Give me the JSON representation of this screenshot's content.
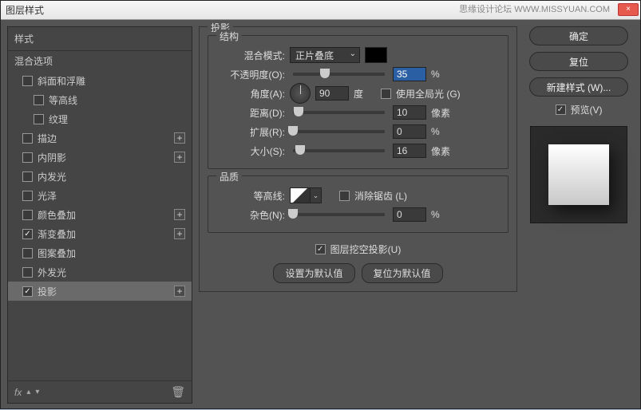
{
  "window": {
    "title": "图层样式",
    "watermark": "思缘设计论坛  WWW.MISSYUAN.COM",
    "close": "×"
  },
  "sidebar": {
    "header": "样式",
    "section": "混合选项",
    "items": [
      {
        "label": "斜面和浮雕",
        "checked": false,
        "plus": false,
        "sub": false
      },
      {
        "label": "等高线",
        "checked": false,
        "plus": false,
        "sub": true
      },
      {
        "label": "纹理",
        "checked": false,
        "plus": false,
        "sub": true
      },
      {
        "label": "描边",
        "checked": false,
        "plus": true,
        "sub": false
      },
      {
        "label": "内阴影",
        "checked": false,
        "plus": true,
        "sub": false
      },
      {
        "label": "内发光",
        "checked": false,
        "plus": false,
        "sub": false
      },
      {
        "label": "光泽",
        "checked": false,
        "plus": false,
        "sub": false
      },
      {
        "label": "颜色叠加",
        "checked": false,
        "plus": true,
        "sub": false
      },
      {
        "label": "渐变叠加",
        "checked": true,
        "plus": true,
        "sub": false
      },
      {
        "label": "图案叠加",
        "checked": false,
        "plus": false,
        "sub": false
      },
      {
        "label": "外发光",
        "checked": false,
        "plus": false,
        "sub": false
      },
      {
        "label": "投影",
        "checked": true,
        "plus": true,
        "sub": false,
        "selected": true
      }
    ],
    "footer": {
      "fx": "fx",
      "plus": "+",
      "trash": "🗑"
    }
  },
  "main": {
    "panel_title": "投影",
    "structure": {
      "title": "结构",
      "blend_label": "混合模式:",
      "blend_value": "正片叠底",
      "opacity_label": "不透明度(O):",
      "opacity_value": "35",
      "opacity_unit": "%",
      "angle_label": "角度(A):",
      "angle_value": "90",
      "angle_unit": "度",
      "global_label": "使用全局光 (G)",
      "distance_label": "距离(D):",
      "distance_value": "10",
      "distance_unit": "像素",
      "spread_label": "扩展(R):",
      "spread_value": "0",
      "spread_unit": "%",
      "size_label": "大小(S):",
      "size_value": "16",
      "size_unit": "像素"
    },
    "quality": {
      "title": "品质",
      "contour_label": "等高线:",
      "antialias_label": "消除锯齿 (L)",
      "noise_label": "杂色(N):",
      "noise_value": "0",
      "noise_unit": "%"
    },
    "knockout_label": "图层挖空投影(U)",
    "btn_default": "设置为默认值",
    "btn_reset": "复位为默认值"
  },
  "right": {
    "ok": "确定",
    "reset": "复位",
    "newstyle": "新建样式 (W)...",
    "preview": "预览(V)"
  }
}
